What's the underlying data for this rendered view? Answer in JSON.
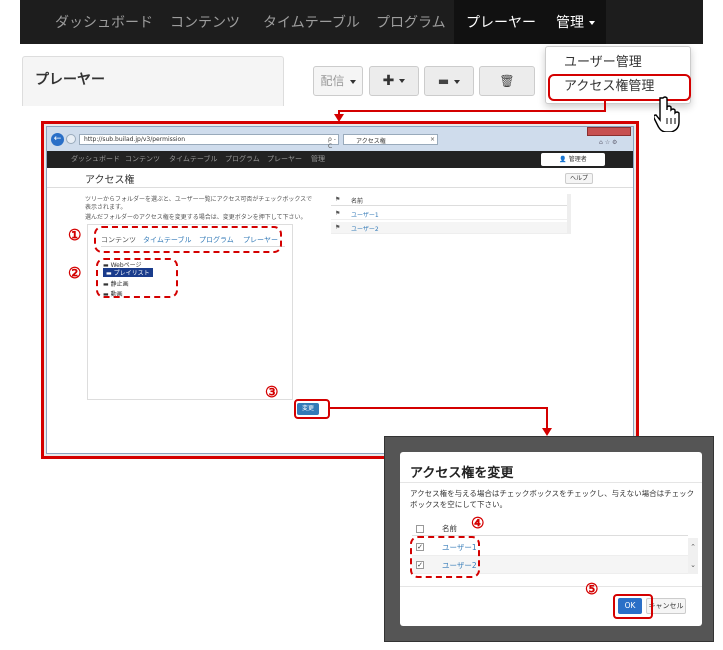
{
  "topnav": {
    "items": [
      "ダッシュボード",
      "コンテンツ",
      "タイムテーブル",
      "プログラム",
      "プレーヤー",
      "管理"
    ]
  },
  "dropdown": {
    "items": [
      "ユーザー管理",
      "アクセス権管理"
    ]
  },
  "panel": {
    "title": "プレーヤー",
    "buttons": [
      "配信"
    ]
  },
  "browser": {
    "url": "http://sub.builad.jp/v3/permission",
    "search": "ρ - C",
    "tab_title": "アクセス権",
    "nav": [
      "ダッシュボード",
      "コンテンツ",
      "タイムテーブル",
      "プログラム",
      "プレーヤー",
      "管理"
    ],
    "user_menu": "管理者",
    "page_title": "アクセス権",
    "help": "ヘルプ",
    "desc1": "ツリーからフォルダーを選ぶと、ユーザー一覧にアクセス可否がチェックボックスで",
    "desc2": "表示されます。",
    "desc3": "選んだフォルダーのアクセス権を変更する場合は、変更ボタンを押下して下さい。",
    "tabs": [
      "コンテンツ",
      "タイムテーブル",
      "プログラム",
      "プレーヤー"
    ],
    "tree": [
      "Webページ",
      "プレイリスト",
      "静止画",
      "動画"
    ],
    "change_btn": "変更",
    "table_header": "名前",
    "users": [
      "ユーザー1",
      "ユーザー2"
    ]
  },
  "dialog": {
    "title": "アクセス権を変更",
    "desc1": "アクセス権を与える場合はチェックボックスをチェックし、与えない場合はチェック",
    "desc2": "ボックスを空にして下さい。",
    "header": "名前",
    "users": [
      "ユーザー1",
      "ユーザー2"
    ],
    "ok": "OK",
    "cancel": "キャンセル"
  },
  "markers": [
    "①",
    "②",
    "③",
    "④",
    "⑤"
  ],
  "colors": {
    "highlight": "#d40000",
    "nav_bg": "#1d1d1d",
    "primary": "#337ab7"
  }
}
